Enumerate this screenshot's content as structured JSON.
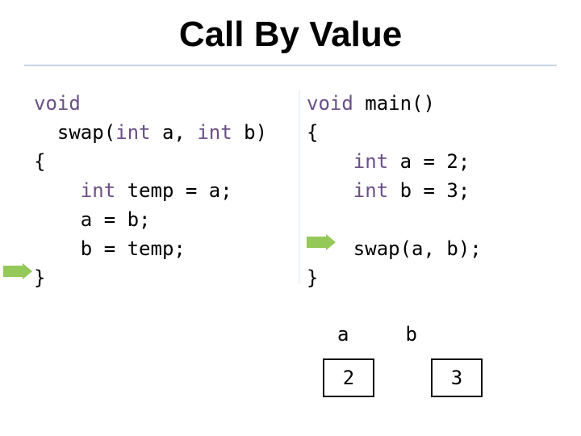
{
  "title": "Call By Value",
  "code_left": {
    "kw_void": "void",
    "line_swap_pre": "  swap(",
    "kw_int1": "int",
    "line_swap_mid": " a, ",
    "kw_int2": "int",
    "line_swap_post": " b)",
    "brace_open": "{",
    "kw_int3": "int",
    "line_temp": " temp = a;",
    "line_ab": "    a = b;",
    "line_btemp": "    b = temp;",
    "brace_close": "}"
  },
  "code_right": {
    "kw_void": "void",
    "line_main": " main()",
    "brace_open": "{",
    "kw_int1": "int",
    "line_a": " a = 2;",
    "kw_int2": "int",
    "line_b": " b = 3;",
    "line_swap": "    swap(a, b);",
    "brace_close": "}"
  },
  "vars": {
    "a_label": "a",
    "b_label": "b",
    "a_value": "2",
    "b_value": "3"
  }
}
